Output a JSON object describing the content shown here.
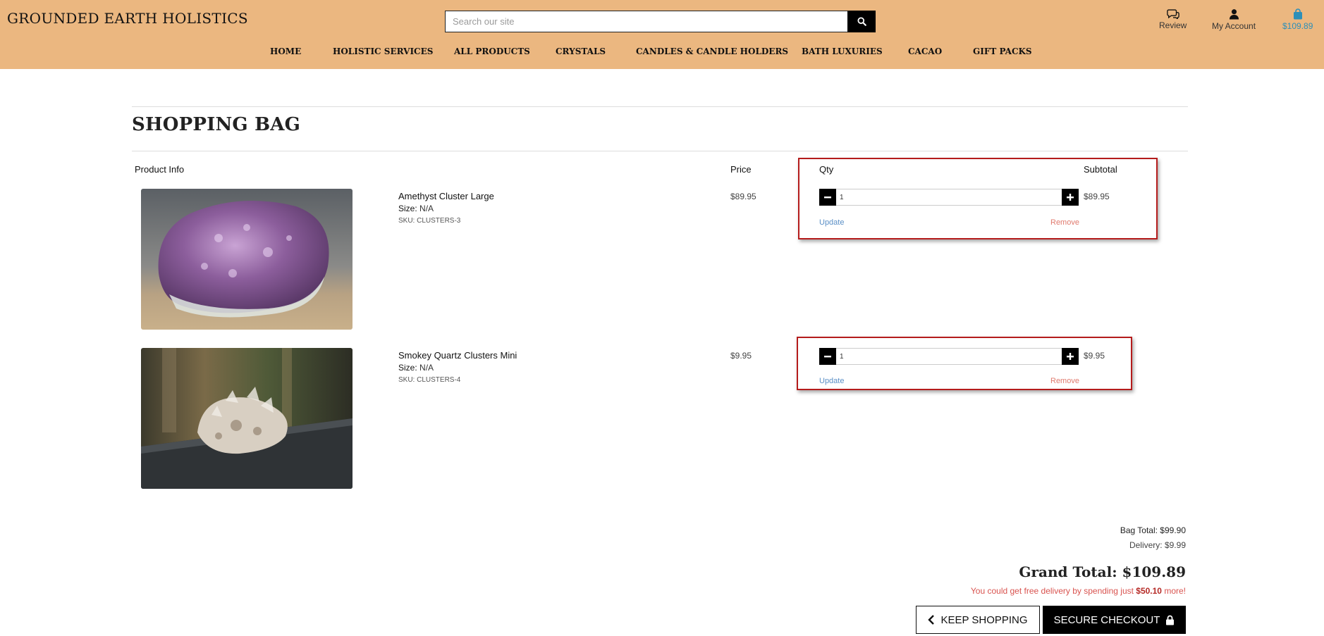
{
  "header": {
    "brand": "GROUNDED EARTH HOLISTICS",
    "search_placeholder": "Search our site",
    "review_label": "Review",
    "account_label": "My Account",
    "bag_total": "$109.89"
  },
  "nav": {
    "items": [
      "HOME",
      "HOLISTIC SERVICES",
      "ALL PRODUCTS",
      "CRYSTALS",
      "CANDLES & CANDLE HOLDERS",
      "BATH LUXURIES",
      "CACAO",
      "GIFT PACKS"
    ]
  },
  "page": {
    "title": "SHOPPING BAG"
  },
  "table": {
    "headers": {
      "product": "Product Info",
      "price": "Price",
      "qty": "Qty",
      "subtotal": "Subtotal"
    },
    "size_label": "Size:",
    "update_label": "Update",
    "remove_label": "Remove"
  },
  "items": [
    {
      "name": "Amethyst Cluster Large",
      "size": "N/A",
      "sku": "SKU: CLUSTERS-3",
      "price": "$89.95",
      "qty": "1",
      "subtotal": "$89.95",
      "image": "amethyst-cluster"
    },
    {
      "name": "Smokey Quartz Clusters Mini",
      "size": "N/A",
      "sku": "SKU: CLUSTERS-4",
      "price": "$9.95",
      "qty": "1",
      "subtotal": "$9.95",
      "image": "smokey-quartz-cluster"
    }
  ],
  "summary": {
    "bag_total": "Bag Total: $99.90",
    "delivery": "Delivery: $9.99",
    "grand_total": "Grand Total: $109.89",
    "free_msg_prefix": "You could get free delivery by spending just ",
    "free_msg_amount": "$50.10",
    "free_msg_suffix": " more!"
  },
  "buttons": {
    "keep_shopping": "KEEP SHOPPING",
    "secure_checkout": "SECURE CHECKOUT"
  },
  "colors": {
    "header_bg": "#ebb780",
    "highlight": "#b51c1c",
    "bag_link": "#2d8fb8",
    "remove": "#e07a6e",
    "update": "#5a8fc6"
  }
}
